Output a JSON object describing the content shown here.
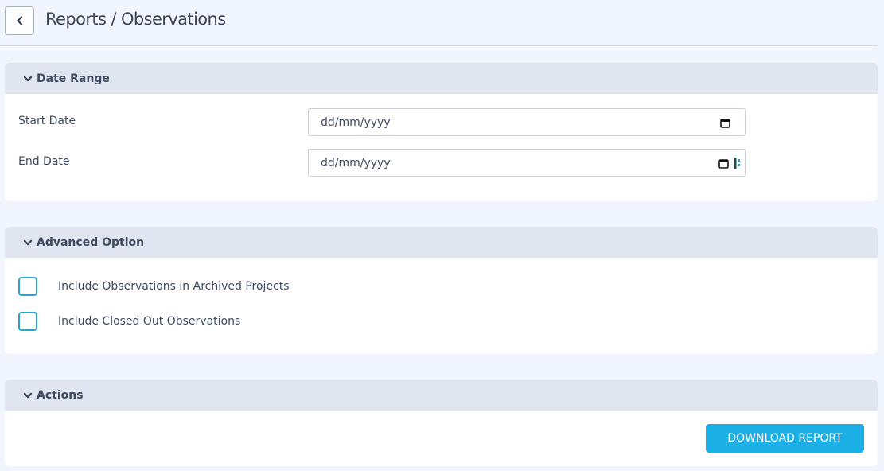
{
  "header": {
    "title": "Reports / Observations"
  },
  "date_range": {
    "title": "Date Range",
    "start_label": "Start Date",
    "start_value": "dd/mm/yyyy",
    "end_label": "End Date",
    "end_value": "dd/mm/yyyy"
  },
  "advanced": {
    "title": "Advanced Option",
    "options": [
      {
        "label": "Include Observations in Archived Projects",
        "checked": false
      },
      {
        "label": "Include Closed Out Observations",
        "checked": false
      }
    ]
  },
  "actions": {
    "title": "Actions",
    "download_label": "DOWNLOAD REPORT"
  },
  "colors": {
    "accent": "#1cb1e6",
    "checkbox_border": "#2aa3cf",
    "panel_header": "#e0e5f0",
    "background": "#f1f5fd"
  },
  "icons": [
    "chevron-left-icon",
    "chevron-down-icon",
    "calendar-icon",
    "grip-icon"
  ]
}
